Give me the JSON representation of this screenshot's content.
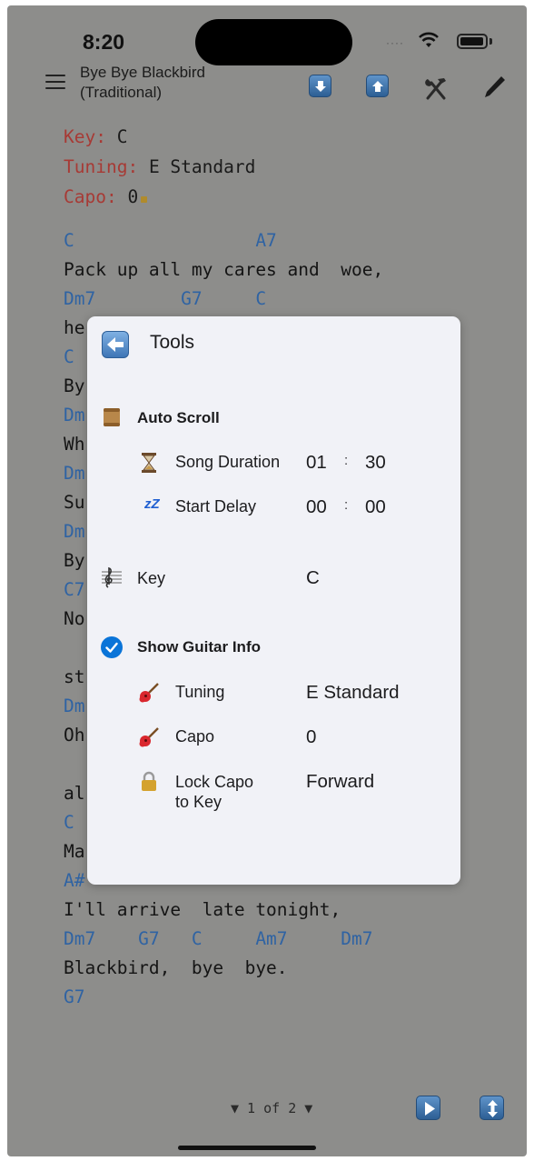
{
  "status_bar": {
    "time": "8:20"
  },
  "toolbar": {
    "title_line1": "Bye Bye Blackbird",
    "title_line2": "(Traditional)"
  },
  "song_meta": {
    "key_label": "Key:",
    "key_value": "C",
    "tuning_label": "Tuning:",
    "tuning_value": "E Standard",
    "capo_label": "Capo:",
    "capo_value": "0"
  },
  "song_lines": [
    {
      "type": "chord",
      "text": "C                 A7"
    },
    {
      "type": "lyric",
      "text": "Pack up all my cares and  woe,"
    },
    {
      "type": "chord",
      "text": "Dm7        G7     C"
    },
    {
      "type": "lyric",
      "text": "he"
    },
    {
      "type": "chord",
      "text": "C"
    },
    {
      "type": "lyric",
      "text": "By"
    },
    {
      "type": "chord",
      "text": "Dm"
    },
    {
      "type": "lyric",
      "text": "Wh"
    },
    {
      "type": "chord",
      "text": "Dm"
    },
    {
      "type": "lyric",
      "text": "Su"
    },
    {
      "type": "chord",
      "text": "Dm"
    },
    {
      "type": "lyric",
      "text": "By"
    },
    {
      "type": "chord",
      "text": "C7"
    },
    {
      "type": "lyric",
      "text": "No"
    },
    {
      "type": "lyric",
      "text": "st"
    },
    {
      "type": "chord",
      "text": "Dm"
    },
    {
      "type": "lyric",
      "text": "Oh"
    },
    {
      "type": "lyric",
      "text": "al"
    },
    {
      "type": "chord",
      "text": "C"
    },
    {
      "type": "lyric",
      "text": "Ma"
    },
    {
      "type": "chord",
      "text": "A#"
    },
    {
      "type": "lyric",
      "text": "I'll arrive  late tonight,"
    },
    {
      "type": "chord",
      "text": "Dm7    G7   C     Am7     Dm7"
    },
    {
      "type": "lyric",
      "text": "Blackbird,  bye  bye."
    },
    {
      "type": "chord",
      "text": "G7"
    }
  ],
  "pager": {
    "text": "▼ 1 of 2 ▼"
  },
  "tools_panel": {
    "title": "Tools",
    "auto_scroll": {
      "label": "Auto Scroll",
      "song_duration_label": "Song Duration",
      "song_duration_min": "01",
      "song_duration_sec": "30",
      "start_delay_label": "Start Delay",
      "start_delay_min": "00",
      "start_delay_sec": "00",
      "separator": ":",
      "sleep_icon_text": "zZ"
    },
    "key": {
      "label": "Key",
      "value": "C"
    },
    "guitar": {
      "label": "Show Guitar Info",
      "checked": true,
      "tuning_label": "Tuning",
      "tuning_value": "E Standard",
      "capo_label": "Capo",
      "capo_value": "0",
      "lock_label_line1": "Lock Capo",
      "lock_label_line2": "to Key",
      "lock_value": "Forward"
    }
  },
  "colors": {
    "background": "#8d8d8b",
    "chord": "#2f63a3",
    "meta_label": "#a73a35",
    "panel": "#f1f2f7",
    "checkbox": "#0a74d8"
  }
}
